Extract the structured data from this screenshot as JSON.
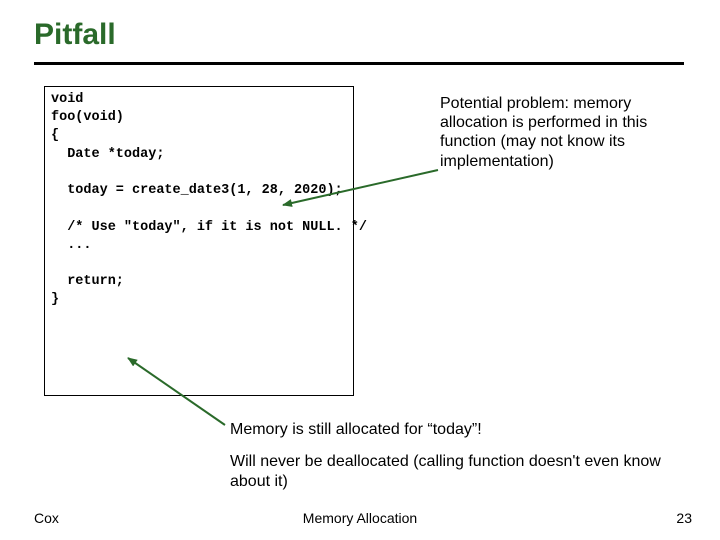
{
  "title": "Pitfall",
  "code": "void\nfoo(void)\n{\n  Date *today;\n\n  today = create_date3(1, 28, 2020);\n\n  /* Use \"today\", if it is not NULL. */\n  ...\n\n  return;\n}",
  "note1": "Potential problem: memory allocation is performed in this function (may not know its implementation)",
  "note2a": "Memory is still allocated for “today”!",
  "note2b": "Will never be deallocated (calling function doesn't even know about it)",
  "footer": {
    "left": "Cox",
    "center": "Memory Allocation",
    "right": "23"
  },
  "colors": {
    "titleColor": "#2a6a2a",
    "arrowColor": "#2a6a2a"
  }
}
